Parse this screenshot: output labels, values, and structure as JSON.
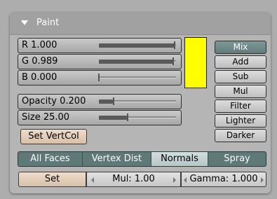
{
  "panel": {
    "title": "Paint",
    "collapse_icon": "triangle-down-icon"
  },
  "color": {
    "r_label": "R 1.000",
    "r": 1.0,
    "g_label": "G 0.989",
    "g": 0.989,
    "b_label": "B 0.000",
    "b": 0.0,
    "swatch": "#ffff00"
  },
  "opacity": {
    "label": "Opacity 0.200",
    "value": 0.2
  },
  "size": {
    "label": "Size 25.00",
    "value": 25.0,
    "max": 64
  },
  "set_vert_col": "Set VertCol",
  "blend_modes": {
    "items": [
      "Mix",
      "Add",
      "Sub",
      "Mul",
      "Filter",
      "Lighter",
      "Darker"
    ],
    "selected": "Mix"
  },
  "tabs": {
    "items": [
      "All Faces",
      "Vertex Dist",
      "Normals",
      "Spray"
    ],
    "selected": "Normals"
  },
  "bottom": {
    "set": "Set",
    "mul": "Mul: 1.00",
    "gamma": "Gamma: 1.000"
  },
  "colors": {
    "selected": "#6e8a8a",
    "panel": "#b5b5b5",
    "header": "#a1a1a1"
  }
}
